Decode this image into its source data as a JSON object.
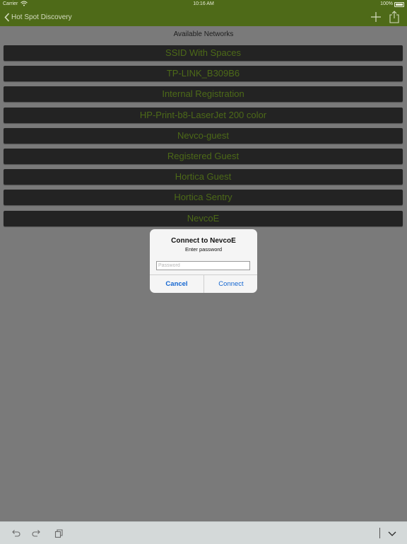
{
  "status_bar": {
    "carrier": "Carrier",
    "time": "10:16 AM",
    "battery": "100%"
  },
  "nav": {
    "back_label": "Hot Spot Discovery"
  },
  "section_title": "Available Networks",
  "networks": [
    "SSID With Spaces",
    "TP-LINK_B309B6",
    "Internal Registration",
    "HP-Print-b8-LaserJet 200 color",
    "Nevco-guest",
    "Registered Guest",
    "Hortica Guest",
    "Hortica Sentry",
    "NevcoE"
  ],
  "dialog": {
    "title": "Connect to NevcoE",
    "message": "Enter password",
    "input_placeholder": "Password",
    "input_value": "",
    "cancel_label": "Cancel",
    "connect_label": "Connect"
  },
  "colors": {
    "nav_bar": "#4e6a18",
    "row_background": "#232323",
    "row_text": "#4d6a18",
    "dialog_button": "#1466d1",
    "dim_background": "#7a7a7a"
  },
  "icons": {
    "nav": [
      "chevron-left-icon",
      "plus-icon",
      "share-icon"
    ],
    "toolbar": [
      "undo-icon",
      "redo-icon",
      "copy-icon",
      "chevron-down-icon"
    ]
  }
}
